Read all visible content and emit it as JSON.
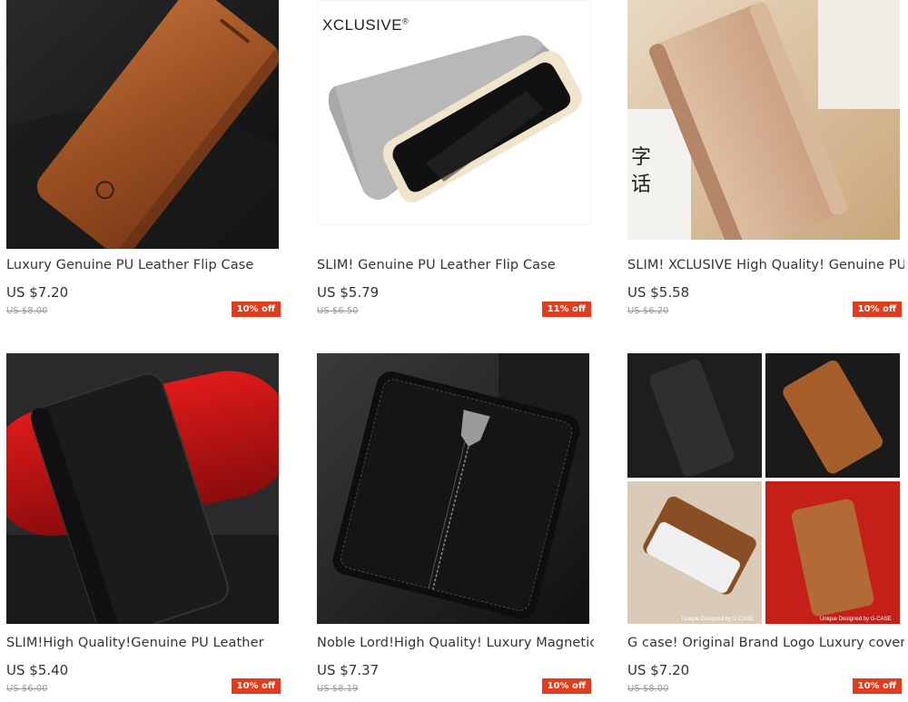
{
  "products": [
    {
      "title": "Luxury Genuine PU Leather Flip Case",
      "price": "US $7.20",
      "old_price": "US $8.00",
      "discount": "10% off"
    },
    {
      "title": "SLIM! Genuine PU Leather Flip Case",
      "price": "US $5.79",
      "old_price": "US $6.50",
      "discount": "11% off",
      "brand": "XCLUSIVE",
      "brand_mark": "®"
    },
    {
      "title": "SLIM! XCLUSIVE High Quality! Genuine PU",
      "price": "US $5.58",
      "old_price": "US $6.20",
      "discount": "10% off"
    },
    {
      "title": "SLIM!High Quality!Genuine PU Leather",
      "price": "US $5.40",
      "old_price": "US $6.00",
      "discount": "10% off"
    },
    {
      "title": "Noble Lord!High Quality! Luxury Magnetic",
      "price": "US $7.37",
      "old_price": "US $8.19",
      "discount": "10% off"
    },
    {
      "title": "G case! Original Brand Logo Luxury cover",
      "price": "US $7.20",
      "old_price": "US $8.00",
      "discount": "10% off",
      "caption_left": "Unique Designed by G-CASE",
      "caption_right": "Unique Designed by G-CASE"
    }
  ],
  "colors": {
    "badge": "#e23b1e",
    "title": "#333333",
    "old_price": "#999999"
  }
}
